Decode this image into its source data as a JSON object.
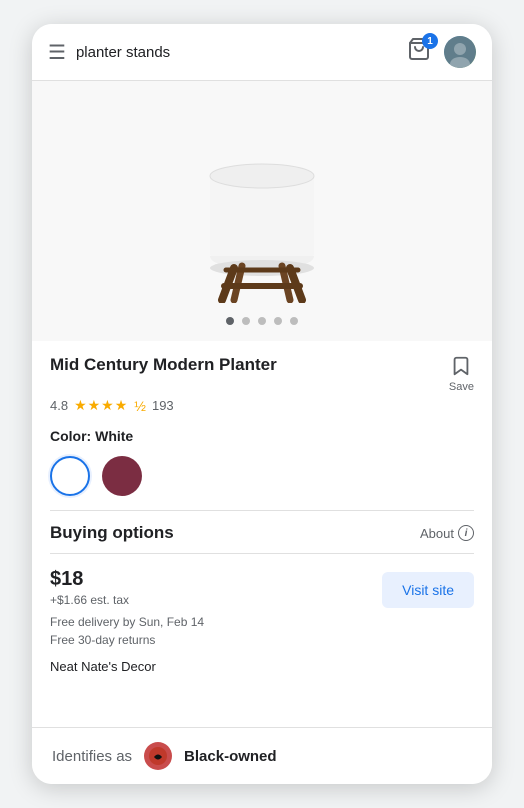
{
  "header": {
    "menu_label": "☰",
    "search_query": "planter stands",
    "cart_badge": "1",
    "cart_icon": "🛒"
  },
  "product": {
    "image_alt": "Mid Century Modern Planter",
    "dots": [
      true,
      false,
      false,
      false,
      false
    ],
    "title": "Mid Century Modern Planter",
    "save_label": "Save",
    "rating": "4.8",
    "stars_full": 4,
    "stars_half": true,
    "review_count": "193",
    "color_label": "Color:",
    "color_value": "White",
    "swatches": [
      {
        "id": "white",
        "label": "White",
        "selected": true
      },
      {
        "id": "maroon",
        "label": "Maroon",
        "selected": false
      }
    ]
  },
  "buying_options": {
    "title": "Buying options",
    "about_label": "About",
    "price": "$18",
    "tax": "+$1.66 est. tax",
    "delivery_line1": "Free delivery by Sun, Feb 14",
    "delivery_line2": "Free 30-day returns",
    "visit_site_label": "Visit site",
    "seller": "Neat Nate's Decor"
  },
  "bottom_bar": {
    "prefix": "Identifies as",
    "badge_icon": "✿",
    "badge_label": "Black-owned",
    "full_text": "Black-owned"
  }
}
